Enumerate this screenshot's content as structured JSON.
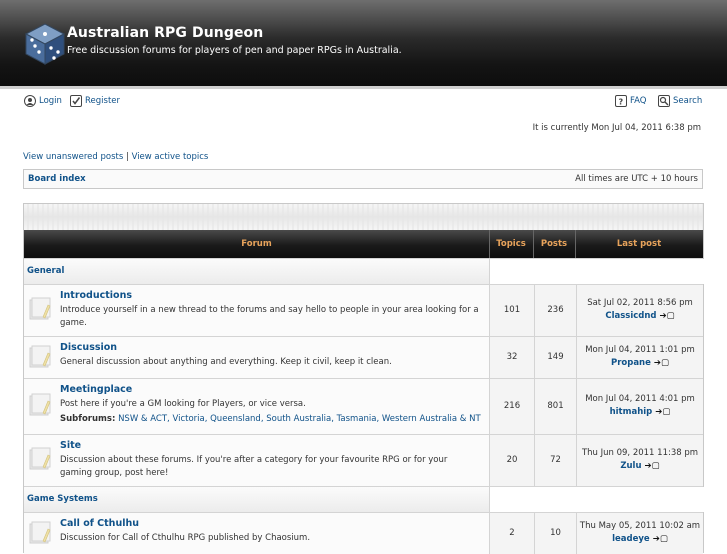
{
  "header": {
    "title": "Australian RPG Dungeon",
    "description": "Free discussion forums for players of pen and paper RPGs in Australia."
  },
  "nav": {
    "login": "Login",
    "register": "Register",
    "faq": "FAQ",
    "search": "Search",
    "current_time": "It is currently Mon Jul 04, 2011 6:38 pm",
    "unanswered": "View unanswered posts",
    "separator": "|",
    "active": "View active topics"
  },
  "breadcrumb": {
    "board_index": "Board index",
    "timezone": "All times are UTC + 10 hours"
  },
  "table": {
    "col_forum": "Forum",
    "col_topics": "Topics",
    "col_posts": "Posts",
    "col_lastpost": "Last post"
  },
  "categories": [
    {
      "name": "General",
      "forums": [
        {
          "title": "Introductions",
          "desc": "Introduce yourself in a new thread to the forums and say hello to people in your area looking for a game.",
          "topics": "101",
          "posts": "236",
          "last_date": "Sat Jul 02, 2011 8:56 pm",
          "last_user": "Classicdnd"
        },
        {
          "title": "Discussion",
          "desc": "General discussion about anything and everything. Keep it civil, keep it clean.",
          "topics": "32",
          "posts": "149",
          "last_date": "Mon Jul 04, 2011 1:01 pm",
          "last_user": "Propane"
        },
        {
          "title": "Meetingplace",
          "desc": "Post here if you're a GM looking for Players, or vice versa.",
          "subforums_label": "Subforums:",
          "subforums": "NSW & ACT, Victoria, Queensland, South Australia, Tasmania, Western Australia & NT",
          "topics": "216",
          "posts": "801",
          "last_date": "Mon Jul 04, 2011 4:01 pm",
          "last_user": "hitmahip"
        },
        {
          "title": "Site",
          "desc": "Discussion about these forums. If you're after a category for your favourite RPG or for your gaming group, post here!",
          "topics": "20",
          "posts": "72",
          "last_date": "Thu Jun 09, 2011 11:38 pm",
          "last_user": "Zulu"
        }
      ]
    },
    {
      "name": "Game Systems",
      "forums": [
        {
          "title": "Call of Cthulhu",
          "desc": "Discussion for Call of Cthulhu RPG published by Chaosium.",
          "topics": "2",
          "posts": "10",
          "last_date": "Thu May 05, 2011 10:02 am",
          "last_user": "leadeye"
        }
      ]
    }
  ],
  "colors": {
    "link": "#105289",
    "header_text": "#e8a35b",
    "header_bg": "#141414"
  }
}
